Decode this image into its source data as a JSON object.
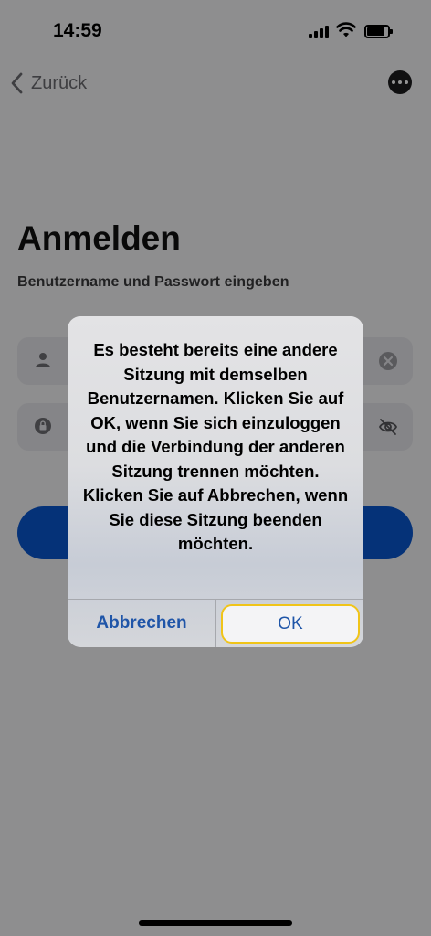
{
  "status_bar": {
    "time": "14:59"
  },
  "nav": {
    "back_label": "Zurück"
  },
  "page": {
    "title": "Anmelden",
    "subtitle": "Benutzername und Passwort eingeben"
  },
  "alert": {
    "message": "Es besteht bereits eine andere Sitzung mit demselben Benutzernamen. Klicken Sie auf OK, wenn Sie sich einzuloggen und die Verbindung der anderen Sitzung trennen möchten. Klicken Sie auf Abbrechen, wenn Sie diese Sitzung beenden möchten.",
    "cancel_label": "Abbrechen",
    "ok_label": "OK"
  },
  "colors": {
    "accent": "#0a57cf",
    "focus": "#f0c419",
    "alert_button_text": "#1f55a8"
  },
  "icons": {
    "back": "chevron-left-icon",
    "more": "more-icon",
    "user": "user-icon",
    "lock": "lock-icon",
    "clear": "clear-icon",
    "visibility": "eye-off-icon"
  }
}
